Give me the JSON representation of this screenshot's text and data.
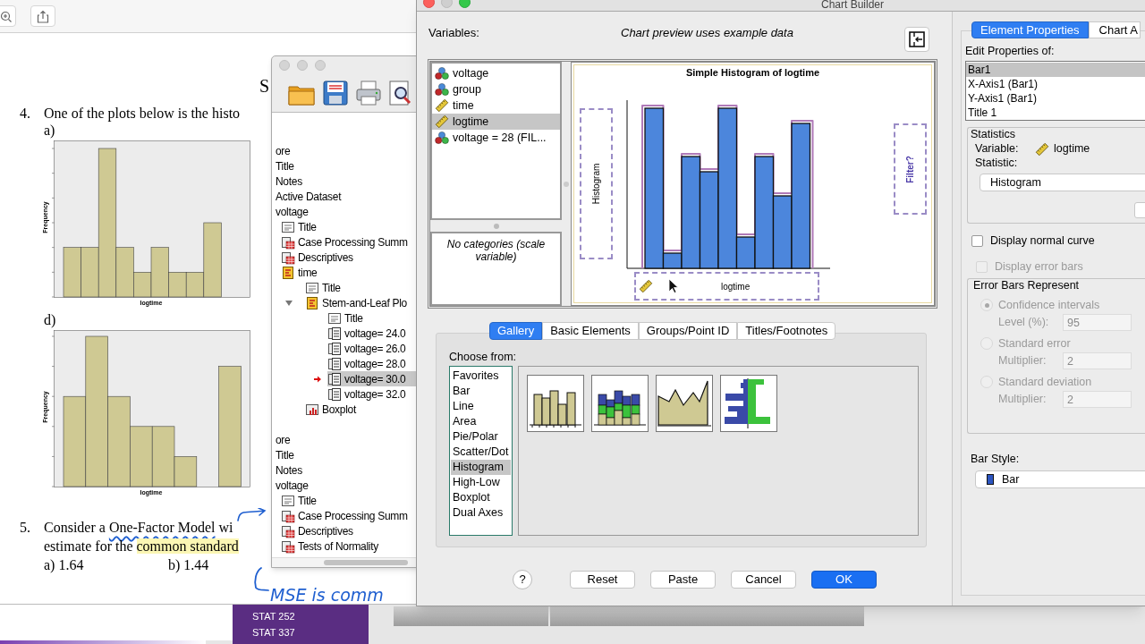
{
  "pdf_viewer": {
    "document": {
      "partial_heading": "S",
      "questions": [
        {
          "number": "4.",
          "lines": [
            [
              {
                "text": "One of the plots below is the histo",
                "kind": "plain"
              }
            ]
          ],
          "plots": [
            {
              "label": "a)",
              "xlabel": "logtime",
              "ylabel": "Frequency"
            },
            {
              "label": "d)",
              "xlabel": "logtime",
              "ylabel": "Frequency"
            }
          ]
        },
        {
          "number": "5.",
          "lines": [
            [
              {
                "text": "Consider a ",
                "kind": "plain"
              },
              {
                "text": "One-Factor Model",
                "kind": "underline"
              },
              {
                "text": " wi",
                "kind": "plain"
              }
            ],
            [
              {
                "text": "estimate for the ",
                "kind": "plain"
              },
              {
                "text": "common standard",
                "kind": "highlight"
              }
            ]
          ],
          "options": [
            "a) 1.64",
            "b) 1.44"
          ]
        }
      ],
      "handwriting": "MSE is comm"
    }
  },
  "output_viewer": {
    "tree_sections": [
      [
        {
          "label": "ore",
          "selected": false
        },
        {
          "label": "Title",
          "selected": false
        },
        {
          "label": "Notes",
          "selected": false
        },
        {
          "label": "Active Dataset",
          "selected": false
        },
        {
          "label": "voltage",
          "selected": false,
          "children": [
            {
              "label": "Title",
              "kind": "title",
              "selected": false
            },
            {
              "label": "Case Processing Summ",
              "kind": "table",
              "selected": false
            },
            {
              "label": "Descriptives",
              "kind": "table",
              "selected": false
            },
            {
              "label": "time",
              "kind": "heading",
              "selected": false,
              "children": [
                {
                  "label": "Title",
                  "kind": "title",
                  "selected": false
                },
                {
                  "label": "Stem-and-Leaf Plo",
                  "kind": "heading",
                  "selected": false,
                  "expanded": true,
                  "children": [
                    {
                      "label": "Title",
                      "kind": "title",
                      "selected": false
                    },
                    {
                      "label": "voltage= 24.0",
                      "kind": "text",
                      "selected": false
                    },
                    {
                      "label": "voltage= 26.0",
                      "kind": "text",
                      "selected": false
                    },
                    {
                      "label": "voltage= 28.0",
                      "kind": "text",
                      "selected": false
                    },
                    {
                      "label": "voltage= 30.0",
                      "kind": "text",
                      "selected": true
                    },
                    {
                      "label": "voltage= 32.0",
                      "kind": "text",
                      "selected": false
                    }
                  ]
                },
                {
                  "label": "Boxplot",
                  "kind": "chart",
                  "selected": false
                }
              ]
            }
          ]
        }
      ],
      [
        {
          "label": "ore",
          "selected": false
        },
        {
          "label": "Title",
          "selected": false
        },
        {
          "label": "Notes",
          "selected": false
        },
        {
          "label": "voltage",
          "selected": false,
          "children": [
            {
              "label": "Title",
              "kind": "title",
              "selected": false
            },
            {
              "label": "Case Processing Summ",
              "kind": "table",
              "selected": false
            },
            {
              "label": "Descriptives",
              "kind": "table",
              "selected": false
            },
            {
              "label": "Tests of Normality",
              "kind": "table",
              "selected": false
            }
          ]
        }
      ]
    ]
  },
  "chart_builder": {
    "window": {
      "title": "Chart Builder"
    },
    "variables_label": "Variables:",
    "preview_note": "Chart preview uses example data",
    "variables": [
      {
        "name": "voltage",
        "kind": "nominal",
        "selected": false
      },
      {
        "name": "group",
        "kind": "nominal",
        "selected": false
      },
      {
        "name": "time",
        "kind": "scale",
        "selected": false
      },
      {
        "name": "logtime",
        "kind": "scale",
        "selected": true
      },
      {
        "name": "voltage = 28 (FIL...",
        "kind": "nominal",
        "selected": false
      }
    ],
    "categories_note": "No categories (scale variable)",
    "preview": {
      "title": "Simple Histogram of logtime",
      "y_drop_zone": "Histogram",
      "x_drop_zone": "logtime",
      "filter_zone": "Filter?"
    },
    "tabs": [
      {
        "label": "Gallery",
        "selected": true
      },
      {
        "label": "Basic Elements",
        "selected": false
      },
      {
        "label": "Groups/Point ID",
        "selected": false
      },
      {
        "label": "Titles/Footnotes",
        "selected": false
      }
    ],
    "gallery": {
      "label": "Choose from:",
      "types": [
        {
          "label": "Favorites",
          "selected": false
        },
        {
          "label": "Bar",
          "selected": false
        },
        {
          "label": "Line",
          "selected": false
        },
        {
          "label": "Area",
          "selected": false
        },
        {
          "label": "Pie/Polar",
          "selected": false
        },
        {
          "label": "Scatter/Dot",
          "selected": false
        },
        {
          "label": "Histogram",
          "selected": true
        },
        {
          "label": "High-Low",
          "selected": false
        },
        {
          "label": "Boxplot",
          "selected": false
        },
        {
          "label": "Dual Axes",
          "selected": false
        }
      ]
    },
    "buttons": [
      {
        "label": "?",
        "kind": "help"
      },
      {
        "label": "Reset",
        "kind": "normal"
      },
      {
        "label": "Paste",
        "kind": "normal"
      },
      {
        "label": "Cancel",
        "kind": "normal"
      },
      {
        "label": "OK",
        "kind": "default"
      }
    ],
    "properties": {
      "tabs": [
        {
          "label": "Element Properties",
          "selected": true
        },
        {
          "label": "Chart A",
          "selected": false
        }
      ],
      "edit_label": "Edit Properties of:",
      "elements": [
        {
          "label": "Bar1",
          "selected": true
        },
        {
          "label": "X-Axis1 (Bar1)",
          "selected": false
        },
        {
          "label": "Y-Axis1 (Bar1)",
          "selected": false
        },
        {
          "label": "Title 1",
          "selected": false
        }
      ],
      "statistics": {
        "title": "Statistics",
        "variable_label": "Variable:",
        "variable": "logtime",
        "statistic_label": "Statistic:",
        "statistic": "Histogram"
      },
      "options": [
        {
          "label": "Display normal curve",
          "checked": false,
          "disabled": false
        },
        {
          "label": "Display error bars",
          "checked": false,
          "disabled": true
        }
      ],
      "error_bars": {
        "title": "Error Bars Represent",
        "disabled": true,
        "choices": [
          {
            "label": "Confidence intervals",
            "selected": true,
            "field_label": "Level (%):",
            "value": "95"
          },
          {
            "label": "Standard error",
            "selected": false,
            "field_label": "Multiplier:",
            "value": "2"
          },
          {
            "label": "Standard deviation",
            "selected": false,
            "field_label": "Multiplier:",
            "value": "2"
          }
        ]
      },
      "bar_style": {
        "label": "Bar Style:",
        "value": "Bar"
      }
    }
  },
  "browser_sidebar": {
    "items": [
      "STAT 252",
      "STAT 337"
    ]
  }
}
